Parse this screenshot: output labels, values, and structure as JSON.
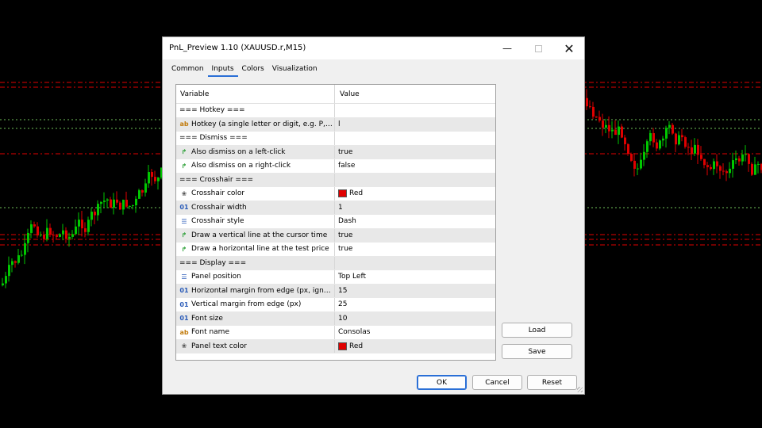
{
  "dialog": {
    "title": "PnL_Preview 1.10 (XAUUSD.r,M15)",
    "minimize_glyph": "—",
    "close_glyph": "✕"
  },
  "tabs": [
    "Common",
    "Inputs",
    "Colors",
    "Visualization"
  ],
  "active_tab": "Inputs",
  "grid": {
    "headers": {
      "variable": "Variable",
      "value": "Value"
    },
    "rows": [
      {
        "type": "section",
        "variable": "=== Hotkey ===",
        "value": ""
      },
      {
        "type": "string",
        "icon": "ab",
        "variable": "Hotkey (a single letter or digit, e.g. P, L...",
        "value": "l"
      },
      {
        "type": "section",
        "variable": "=== Dismiss ===",
        "value": ""
      },
      {
        "type": "bool",
        "icon": "bool-arrow-icon",
        "variable": "Also dismiss on a left-click",
        "value": "true"
      },
      {
        "type": "bool",
        "icon": "bool-arrow-icon",
        "variable": "Also dismiss on a right-click",
        "value": "false"
      },
      {
        "type": "section",
        "variable": "=== Crosshair ===",
        "value": ""
      },
      {
        "type": "color",
        "icon": "color-palette-icon",
        "variable": "Crosshair color",
        "value": "Red",
        "swatch": "#e00000"
      },
      {
        "type": "int",
        "icon": "01",
        "variable": "Crosshair width",
        "value": "1"
      },
      {
        "type": "enum",
        "icon": "enum-list-icon",
        "variable": "Crosshair style",
        "value": "Dash"
      },
      {
        "type": "bool",
        "icon": "bool-arrow-icon",
        "variable": "Draw a vertical line at the cursor time",
        "value": "true"
      },
      {
        "type": "bool",
        "icon": "bool-arrow-icon",
        "variable": "Draw a horizontal line at the test price",
        "value": "true"
      },
      {
        "type": "section",
        "variable": "=== Display ===",
        "value": ""
      },
      {
        "type": "enum",
        "icon": "enum-list-icon",
        "variable": "Panel position",
        "value": "Top Left"
      },
      {
        "type": "int",
        "icon": "01",
        "variable": "Horizontal margin from edge (px, ignore...",
        "value": "15"
      },
      {
        "type": "int",
        "icon": "01",
        "variable": "Vertical margin from edge (px)",
        "value": "25"
      },
      {
        "type": "int",
        "icon": "01",
        "variable": "Font size",
        "value": "10"
      },
      {
        "type": "string",
        "icon": "ab",
        "variable": "Font name",
        "value": "Consolas"
      },
      {
        "type": "color",
        "icon": "color-palette-icon",
        "variable": "Panel text color",
        "value": "Red",
        "swatch": "#e00000"
      }
    ]
  },
  "buttons": {
    "load": "Load",
    "save": "Save",
    "ok": "OK",
    "cancel": "Cancel",
    "reset": "Reset"
  },
  "colors": {
    "chart_bg": "#000000",
    "bull_candle": "#00c800",
    "bear_candle": "#e00000",
    "level_red": "#e00000",
    "level_green": "#6fbf5a",
    "accent": "#2a6fd6"
  }
}
